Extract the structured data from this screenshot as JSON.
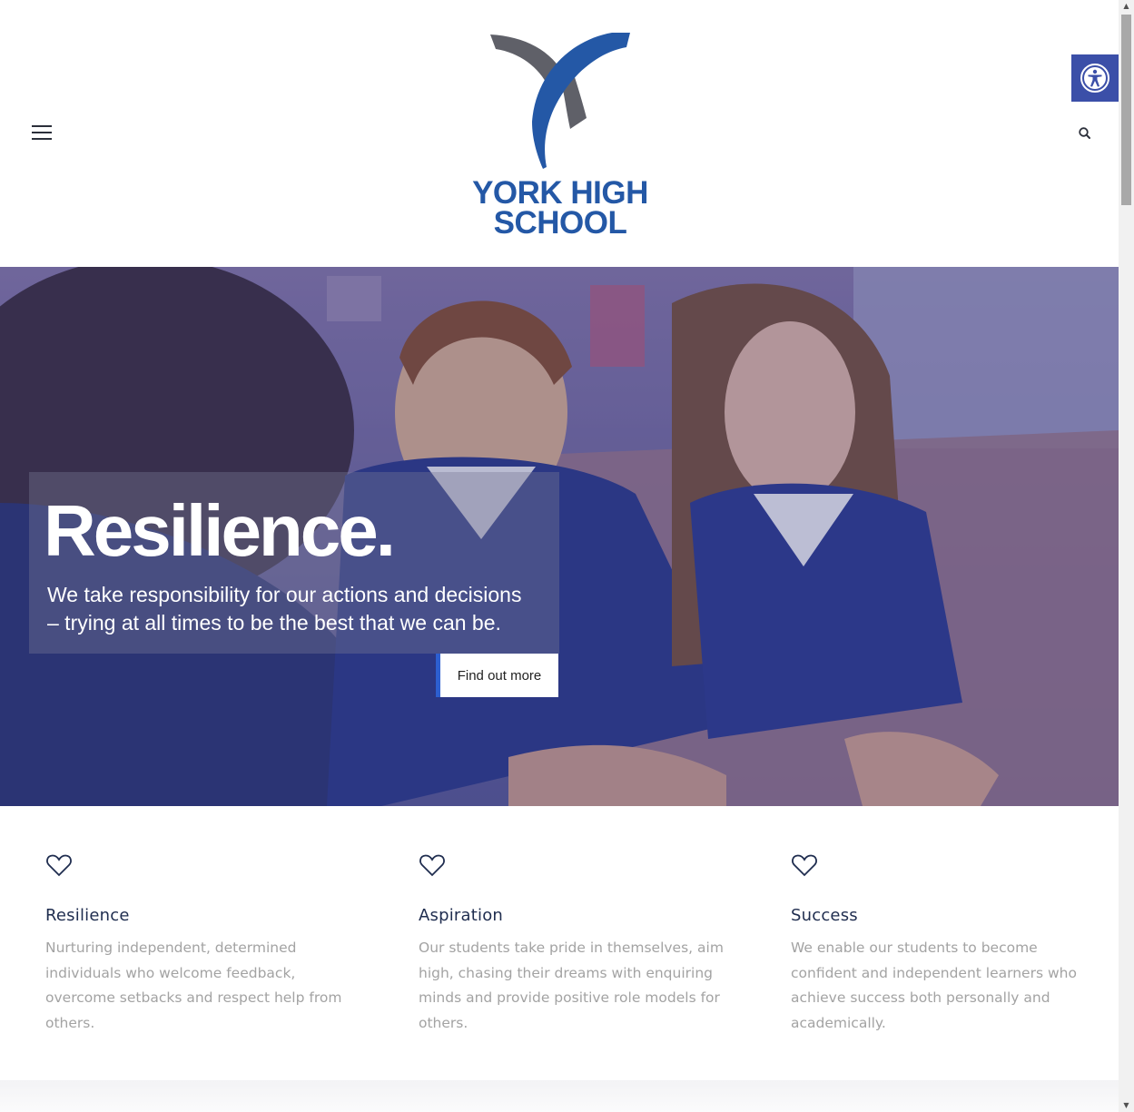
{
  "header": {
    "logo_line1": "YORK HIGH",
    "logo_line2": "SCHOOL",
    "menu_icon": "hamburger-menu-icon",
    "search_icon": "search-icon",
    "accessibility_icon": "accessibility-icon"
  },
  "hero": {
    "title": "Resilience.",
    "subtitle_line1": "We take responsibility for our actions and decisions",
    "subtitle_line2": "– trying at all times to be the best that we can be.",
    "button_label": "Find out more"
  },
  "values": [
    {
      "icon": "heart-icon",
      "title": "Resilience",
      "text": "Nurturing independent, determined individuals who welcome feedback, overcome setbacks and respect help from others."
    },
    {
      "icon": "heart-icon",
      "title": "Aspiration",
      "text": "Our students take pride in themselves, aim high, chasing their dreams with enquiring minds and provide positive role models for others."
    },
    {
      "icon": "heart-icon",
      "title": "Success",
      "text": "We enable our students to become confident and independent learners who achieve success both personally and academically."
    }
  ],
  "colors": {
    "brand_blue": "#2458a6",
    "logo_grey": "#5f6068",
    "accessibility_bg": "#3b4fa8",
    "value_heading": "#1f2d4f",
    "value_text": "#a3a3a3",
    "button_accent": "#2d5fd0"
  }
}
